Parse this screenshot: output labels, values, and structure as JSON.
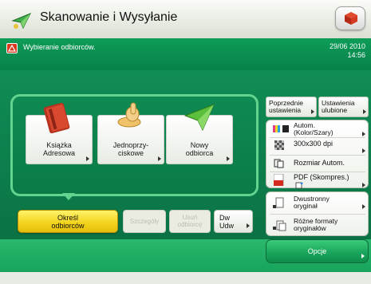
{
  "header": {
    "title": "Skanowanie i Wysyłanie"
  },
  "status": {
    "message": "Wybieranie odbiorców.",
    "date": "29/06 2010",
    "time": "14:56"
  },
  "destination_tiles": [
    {
      "label_line1": "Książka",
      "label_line2": "Adresowa"
    },
    {
      "label_line1": "Jednoprzy-",
      "label_line2": "ciskowe"
    },
    {
      "label_line1": "Nowy",
      "label_line2": "odbiorca"
    }
  ],
  "bottom_buttons": {
    "select_line1": "Określ",
    "select_line2": "odbiorców",
    "details": "Szczegóły",
    "remove_line1": "Usuń",
    "remove_line2": "odbiorcę",
    "dw_line1": "Dw",
    "dw_line2": "Udw"
  },
  "right_panel": {
    "previous_line1": "Poprzednie",
    "previous_line2": "ustawienia",
    "favorites_line1": "Ustawienia",
    "favorites_line2": "ulubione",
    "color_line1": "Autom.",
    "color_line2": "(Kolor/Szary)",
    "resolution": "300x300 dpi",
    "size": "Rozmiar Autom.",
    "format_line1": "PDF (Skompres.)",
    "duplex_line1": "Dwustronny",
    "duplex_line2": "oryginał",
    "mixed_line1": "Różne formaty",
    "mixed_line2": "oryginałów",
    "options": "Opcje"
  },
  "colors": {
    "accent_green": "#0c8a50",
    "highlight_yellow": "#f2d21b"
  }
}
